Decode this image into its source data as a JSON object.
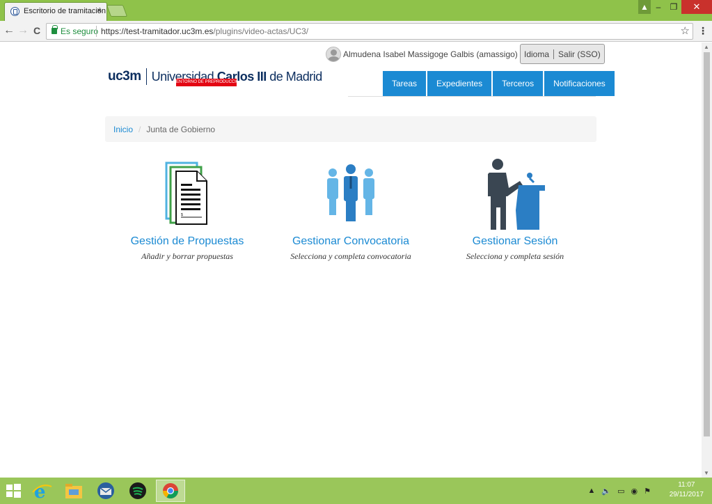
{
  "browser": {
    "tab_title": "Escritorio de tramitación",
    "tab_close": "×",
    "secure_label": "Es seguro",
    "url_host": "https://test-tramitador.uc3m.es",
    "url_path": "/plugins/video-actas/UC3/",
    "back": "←",
    "forward": "→",
    "reload": "C",
    "star": "☆",
    "menu": "⋮",
    "win_minimize": "–",
    "win_restore": "❐",
    "win_close": "✕"
  },
  "header": {
    "username": "Almudena Isabel Massigoge Galbis (amassigo)",
    "bell": "🔔",
    "language": "Idioma",
    "logout": "Salir (SSO)",
    "logo_uc3m": "uc3m",
    "logo_univ_pre": "Universidad ",
    "logo_univ_bold": "Carlos III",
    "logo_univ_post": " de Madrid",
    "preprod_banner": "ENTORNO DE PREPRODUCCIÓN"
  },
  "nav": {
    "items": [
      {
        "label": "Tareas"
      },
      {
        "label": "Expedientes"
      },
      {
        "label": "Terceros"
      },
      {
        "label": "Notificaciones"
      }
    ]
  },
  "breadcrumb": {
    "home": "Inicio",
    "separator": "/",
    "current": "Junta de Gobierno"
  },
  "cards": [
    {
      "icon": "documents-icon",
      "title": "Gestión de Propuestas",
      "subtitle": "Añadir y borrar propuestas"
    },
    {
      "icon": "people-group-icon",
      "title": "Gestionar Convocatoria",
      "subtitle": "Selecciona y completa convocatoria"
    },
    {
      "icon": "speaker-podium-icon",
      "title": "Gestionar Sesión",
      "subtitle": "Selecciona y completa sesión"
    }
  ],
  "taskbar": {
    "time": "11:07",
    "date": "29/11/2017"
  },
  "colors": {
    "accent": "#1b8ad3",
    "chrome_green": "#8fc24a",
    "preprod_red": "#e30613"
  }
}
